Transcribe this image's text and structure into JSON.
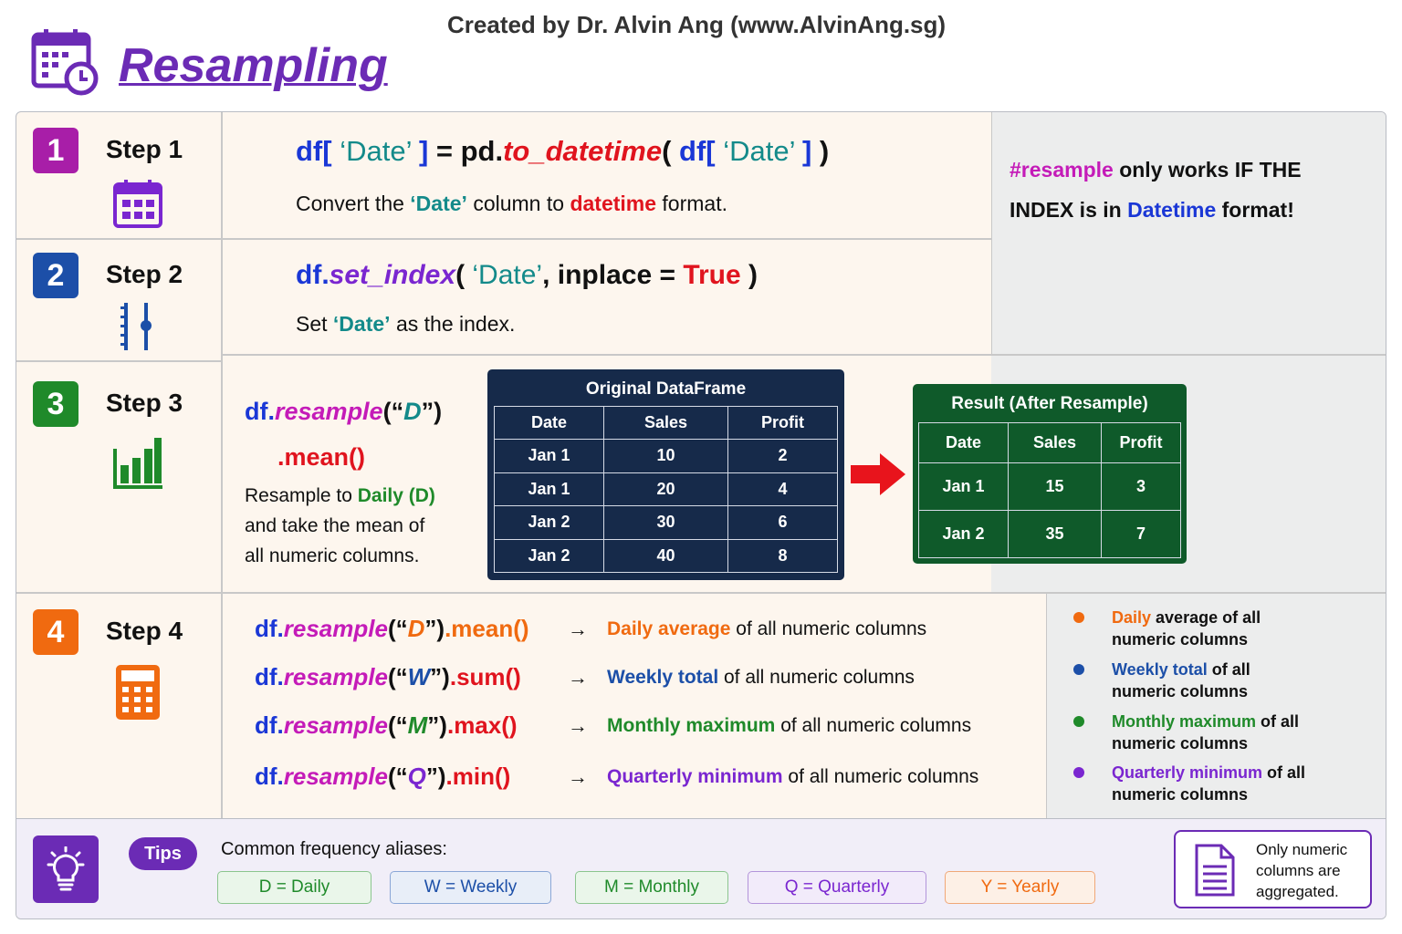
{
  "header": {
    "credit": "Created by Dr. Alvin Ang (www.AlvinAng.sg)",
    "title": "Resampling"
  },
  "colors": {
    "step1": "#a81ea8",
    "step2": "#1c4fa8",
    "step3": "#1f8a2a",
    "step4": "#f06a10",
    "table_original": "#162a4a",
    "table_result": "#0f5a2a",
    "tips": "#6b2bb5"
  },
  "steps": [
    {
      "num": "1",
      "label": "Step 1",
      "icon": "calendar-icon",
      "code": {
        "p1": "df[",
        "p2": " ‘Date’ ",
        "p3": "]",
        "p4": " = pd.",
        "p5": "to_datetime",
        "p6": "( ",
        "p7": "df[",
        "p8": " ‘Date’ ",
        "p9": "]",
        "p10": " )"
      },
      "desc": {
        "a": "Convert the ",
        "b": "‘Date’",
        "c": " column to ",
        "d": "datetime",
        "e": " format."
      }
    },
    {
      "num": "2",
      "label": "Step 2",
      "icon": "index-ruler-icon",
      "code": {
        "p1": "df.",
        "p2": "set_index",
        "p3": "( ",
        "p4": "‘Date’",
        "p5": ", inplace = ",
        "p6": "True",
        "p7": " )"
      },
      "desc": {
        "a": "Set ",
        "b": "‘Date’",
        "c": " as the index."
      }
    },
    {
      "num": "3",
      "label": "Step 3",
      "icon": "bar-chart-icon",
      "code": {
        "p1": "df.",
        "p2": "resample",
        "p3": "(“",
        "p4": "D",
        "p5": "”)",
        "p6": ".mean()"
      },
      "desc": {
        "a": "Resample to ",
        "b": "Daily (D)",
        "c": "and take the mean of",
        "d": "all numeric columns."
      }
    },
    {
      "num": "4",
      "label": "Step 4",
      "icon": "calculator-icon"
    }
  ],
  "note": {
    "a": "#resample",
    "b": " only works IF THE",
    "c": "INDEX is in ",
    "d": "Datetime",
    "e": " format!"
  },
  "original": {
    "title": "Original DataFrame",
    "headers": [
      "Date",
      "Sales",
      "Profit"
    ],
    "rows": [
      [
        "Jan 1",
        "10",
        "2"
      ],
      [
        "Jan 1",
        "20",
        "4"
      ],
      [
        "Jan 2",
        "30",
        "6"
      ],
      [
        "Jan 2",
        "40",
        "8"
      ]
    ]
  },
  "result": {
    "title": "Result (After Resample)",
    "headers": [
      "Date",
      "Sales",
      "Profit"
    ],
    "rows": [
      [
        "Jan 1",
        "15",
        "3"
      ],
      [
        "Jan 2",
        "35",
        "7"
      ]
    ]
  },
  "examples": [
    {
      "df": "df.",
      "fn": "resample",
      "o": "(“",
      "code": "D",
      "c": "”)",
      "agg": ".mean()",
      "arrow": "→",
      "hl": "Daily average",
      "rest": " of all numeric columns"
    },
    {
      "df": "df.",
      "fn": "resample",
      "o": "(“",
      "code": "W",
      "c": "”)",
      "agg": ".sum()",
      "arrow": "→",
      "hl": "Weekly total",
      "rest": " of all numeric columns"
    },
    {
      "df": "df.",
      "fn": "resample",
      "o": "(“",
      "code": "M",
      "c": "”)",
      "agg": ".max()",
      "arrow": "→",
      "hl": "Monthly maximum",
      "rest": " of all numeric columns"
    },
    {
      "df": "df.",
      "fn": "resample",
      "o": "(“",
      "code": "Q",
      "c": "”)",
      "agg": ".min()",
      "arrow": "→",
      "hl": "Quarterly minimum",
      "rest": " of all numeric columns"
    }
  ],
  "legend": [
    {
      "hl": "Daily",
      "rest1": " average of all",
      "rest2": "numeric columns"
    },
    {
      "hl": "Weekly total",
      "rest1": " of all",
      "rest2": "numeric columns"
    },
    {
      "hl": "Monthly maximum",
      "rest1": " of all",
      "rest2": "numeric columns"
    },
    {
      "hl": "Quarterly minimum",
      "rest1": " of all",
      "rest2": "numeric columns"
    }
  ],
  "tips": {
    "icon": "lightbulb-icon",
    "badge": "Tips",
    "heading": "Common frequency aliases:",
    "aliases": [
      "D = Daily",
      "W = Weekly",
      "M = Monthly",
      "Q = Quarterly",
      "Y = Yearly"
    ],
    "note_icon": "document-icon",
    "note_l1": "Only numeric",
    "note_l2": "columns are",
    "note_l3": "aggregated."
  }
}
